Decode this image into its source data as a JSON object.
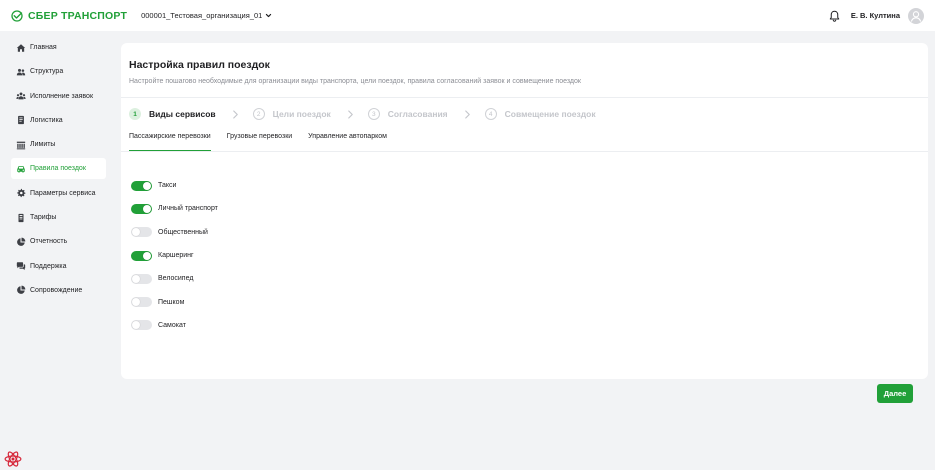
{
  "header": {
    "brand": "СБЕР ТРАНСПОРТ",
    "organization": "000001_Тестовая_организация_01",
    "user_name": "Е. В. Култина",
    "brand_color": "#21a038"
  },
  "sidebar": {
    "items": [
      {
        "label": "Главная",
        "icon": "home-icon",
        "active": false
      },
      {
        "label": "Структура",
        "icon": "users-icon",
        "active": false
      },
      {
        "label": "Исполнение заявок",
        "icon": "team-icon",
        "active": false
      },
      {
        "label": "Логистика",
        "icon": "document-icon",
        "active": false
      },
      {
        "label": "Лимиты",
        "icon": "limits-icon",
        "active": false
      },
      {
        "label": "Правила поездок",
        "icon": "car-icon",
        "active": true
      },
      {
        "label": "Параметры сервиса",
        "icon": "gear-icon",
        "active": false
      },
      {
        "label": "Тарифы",
        "icon": "tariff-icon",
        "active": false
      },
      {
        "label": "Отчетность",
        "icon": "pie-chart-icon",
        "active": false
      },
      {
        "label": "Поддержка",
        "icon": "chat-icon",
        "active": false
      },
      {
        "label": "Сопровождение",
        "icon": "pie-chart-icon",
        "active": false
      }
    ]
  },
  "main": {
    "title": "Настройка правил поездок",
    "subtitle": "Настройте пошагово необходимые для организации виды транспорта, цели поездок, правила согласований заявок и совмещение поездок",
    "steps": [
      {
        "number": "1",
        "label": "Виды сервисов",
        "active": true
      },
      {
        "number": "2",
        "label": "Цели поездок",
        "active": false
      },
      {
        "number": "3",
        "label": "Согласования",
        "active": false
      },
      {
        "number": "4",
        "label": "Совмещение поездок",
        "active": false
      }
    ],
    "tabs": [
      {
        "label": "Пассажирские перевозки",
        "active": true
      },
      {
        "label": "Грузовые перевозки",
        "active": false
      },
      {
        "label": "Управление автопарком",
        "active": false
      }
    ],
    "toggles": [
      {
        "label": "Такси",
        "on": true
      },
      {
        "label": "Личный транспорт",
        "on": true
      },
      {
        "label": "Общественный",
        "on": false
      },
      {
        "label": "Каршеринг",
        "on": true
      },
      {
        "label": "Велосипед",
        "on": false
      },
      {
        "label": "Пешком",
        "on": false
      },
      {
        "label": "Самокат",
        "on": false
      }
    ]
  },
  "footer": {
    "next_label": "Далее"
  }
}
